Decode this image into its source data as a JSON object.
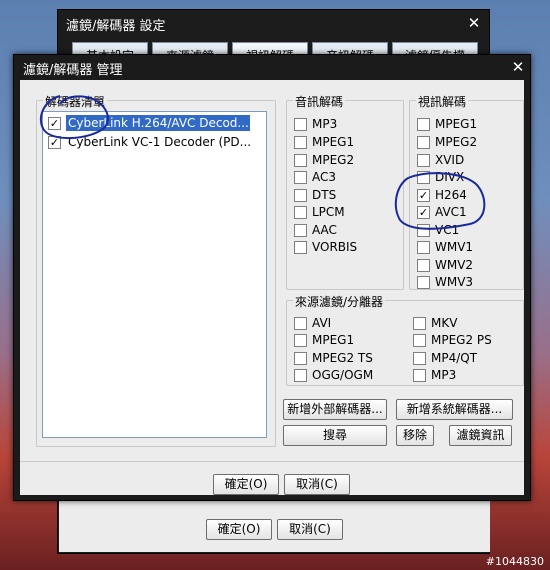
{
  "background_dialog": {
    "title": "濾鏡/解碼器 設定",
    "tabs": [
      "基本設定",
      "來源濾鏡",
      "視訊解碼",
      "音訊解碼",
      "濾鏡優先權"
    ],
    "ok_label": "確定(O)",
    "cancel_label": "取消(C)"
  },
  "dialog": {
    "title": "濾鏡/解碼器 管理",
    "decoder_list": {
      "legend": "解碼器清單",
      "items": [
        {
          "label": "CyberLink H.264/AVC Decod...",
          "checked": true,
          "selected": true
        },
        {
          "label": "CyberLink VC-1 Decoder (PD...",
          "checked": true,
          "selected": false
        }
      ]
    },
    "audio": {
      "legend": "音訊解碼",
      "options": [
        {
          "label": "MP3",
          "checked": false
        },
        {
          "label": "MPEG1",
          "checked": false
        },
        {
          "label": "MPEG2",
          "checked": false
        },
        {
          "label": "AC3",
          "checked": false
        },
        {
          "label": "DTS",
          "checked": false
        },
        {
          "label": "LPCM",
          "checked": false
        },
        {
          "label": "AAC",
          "checked": false
        },
        {
          "label": "VORBIS",
          "checked": false
        }
      ]
    },
    "video": {
      "legend": "視訊解碼",
      "options": [
        {
          "label": "MPEG1",
          "checked": false
        },
        {
          "label": "MPEG2",
          "checked": false
        },
        {
          "label": "XVID",
          "checked": false
        },
        {
          "label": "DIVX",
          "checked": false
        },
        {
          "label": "H264",
          "checked": true
        },
        {
          "label": "AVC1",
          "checked": true
        },
        {
          "label": "VC1",
          "checked": false
        },
        {
          "label": "WMV1",
          "checked": false
        },
        {
          "label": "WMV2",
          "checked": false
        },
        {
          "label": "WMV3",
          "checked": false
        }
      ]
    },
    "source": {
      "legend": "來源濾鏡/分離器",
      "options": [
        {
          "label": "AVI",
          "checked": false
        },
        {
          "label": "MKV",
          "checked": false
        },
        {
          "label": "MPEG1",
          "checked": false
        },
        {
          "label": "MPEG2 PS",
          "checked": false
        },
        {
          "label": "MPEG2 TS",
          "checked": false
        },
        {
          "label": "MP4/QT",
          "checked": false
        },
        {
          "label": "OGG/OGM",
          "checked": false
        },
        {
          "label": "MP3",
          "checked": false
        }
      ]
    },
    "buttons": {
      "add_external": "新增外部解碼器...",
      "add_system": "新增系統解碼器...",
      "search": "搜尋",
      "remove": "移除",
      "filter_info": "濾鏡資訊",
      "ok": "確定(O)",
      "cancel": "取消(C)"
    }
  },
  "watermark": "#1044830",
  "colors": {
    "selection": "#316ac5",
    "annotation_ink": "#1a2a9a",
    "title_bar": "#1b1b1b"
  }
}
